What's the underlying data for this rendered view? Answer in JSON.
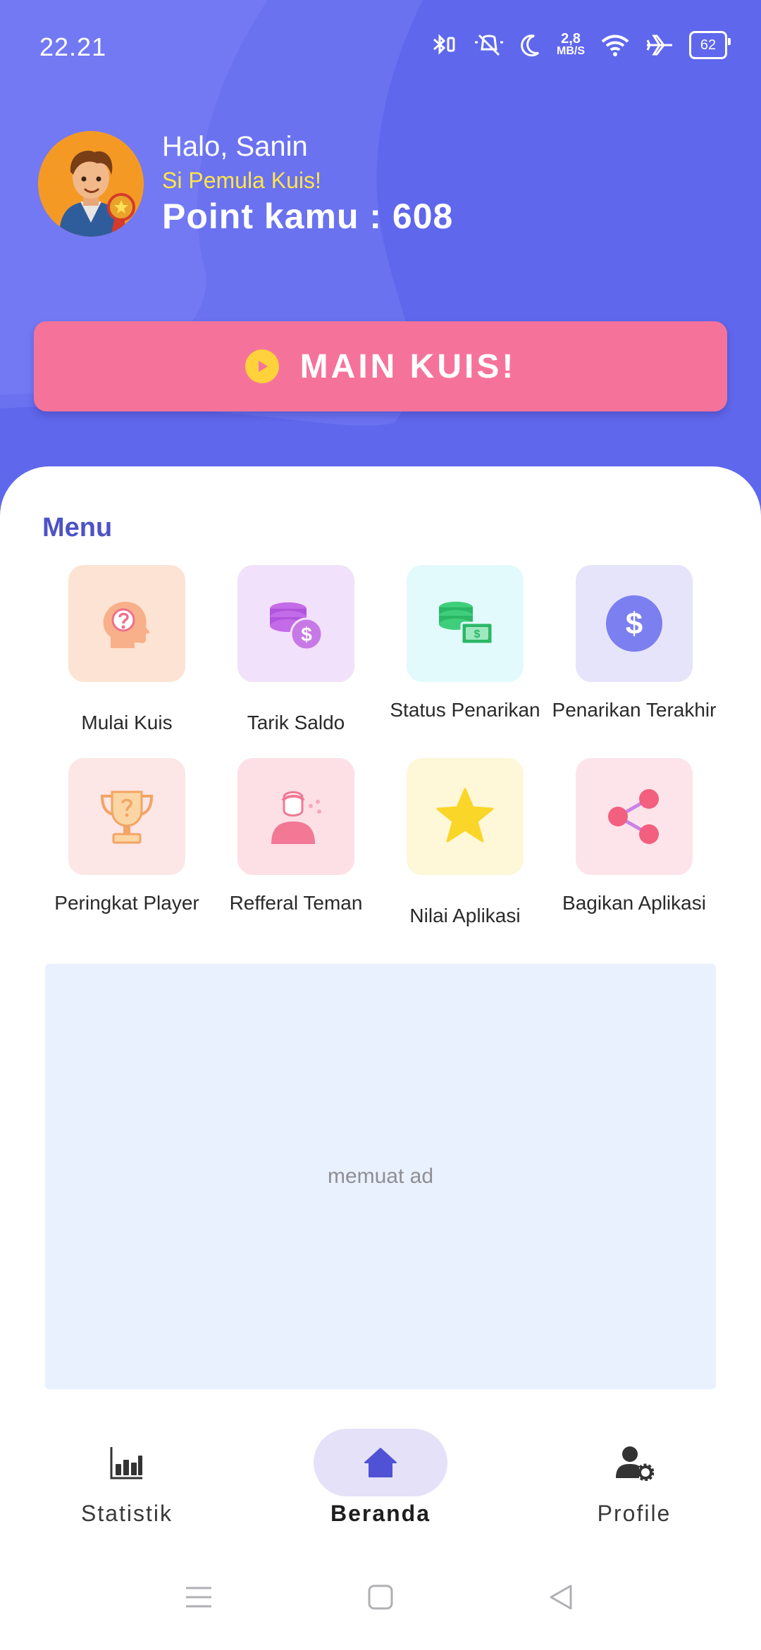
{
  "status_bar": {
    "time": "22.21",
    "net_speed_value": "2,8",
    "net_speed_unit": "MB/S",
    "battery": "62",
    "icons": [
      "bluetooth-icon",
      "vibrate-mute-icon",
      "moon-icon",
      "wifi-icon",
      "airplane-icon",
      "battery-icon"
    ]
  },
  "profile": {
    "greeting": "Halo, Sanin",
    "rank": "Si Pemula Kuis!",
    "points": "Point kamu : 608"
  },
  "play_button": {
    "label": "MAIN KUIS!"
  },
  "menu": {
    "title": "Menu",
    "items": [
      {
        "label": "Mulai Kuis",
        "icon": "head-question-icon",
        "tile_color": "#fde3d3"
      },
      {
        "label": "Tarik Saldo",
        "icon": "coins-dollar-icon",
        "tile_color": "#f2e1fb"
      },
      {
        "label": "Status Penarikan",
        "icon": "coins-cash-icon",
        "tile_color": "#e3fafc"
      },
      {
        "label": "Penarikan Terakhir",
        "icon": "dollar-circle-icon",
        "tile_color": "#e5e4fb"
      },
      {
        "label": "Peringkat Player",
        "icon": "trophy-icon",
        "tile_color": "#fde6e6"
      },
      {
        "label": "Refferal Teman",
        "icon": "person-referral-icon",
        "tile_color": "#fde0e6"
      },
      {
        "label": "Nilai Aplikasi",
        "icon": "star-icon",
        "tile_color": "#fef7d8"
      },
      {
        "label": "Bagikan Aplikasi",
        "icon": "share-icon",
        "tile_color": "#fde4ea"
      }
    ]
  },
  "ad": {
    "text": "memuat ad"
  },
  "bottom_nav": {
    "items": [
      {
        "label": "Statistik",
        "icon": "bar-chart-icon",
        "active": false
      },
      {
        "label": "Beranda",
        "icon": "home-icon",
        "active": true
      },
      {
        "label": "Profile",
        "icon": "user-settings-icon",
        "active": false
      }
    ]
  },
  "colors": {
    "header": "#5f67ec",
    "play_button": "#f5739a",
    "menu_title": "#4d52c7",
    "rank_text": "#ffe54a",
    "nav_active": "#e5e1f9"
  }
}
